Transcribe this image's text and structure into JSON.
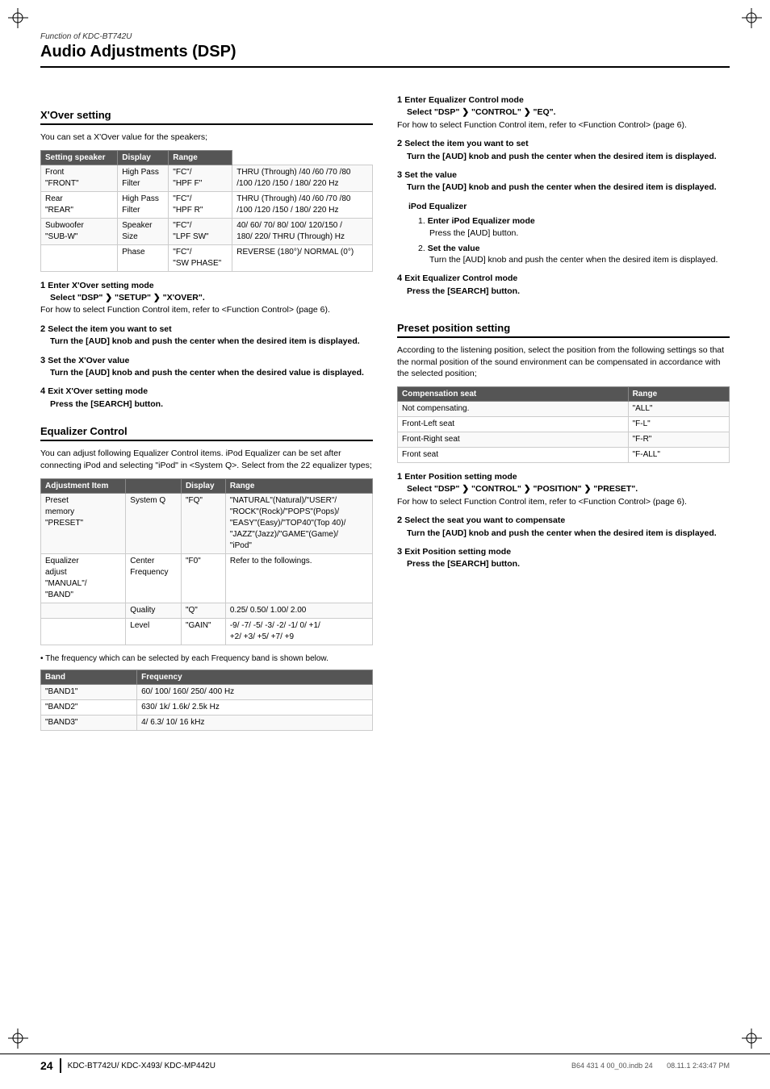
{
  "page": {
    "subtitle": "Function of KDC-BT742U",
    "title": "Audio Adjustments (DSP)"
  },
  "xover": {
    "heading": "X'Over setting",
    "intro": "You can set a X'Over value for the speakers;",
    "table": {
      "headers": [
        "Setting speaker",
        "Display",
        "Range"
      ],
      "rows": [
        [
          "Front\n\"FRONT\"",
          "High Pass Filter",
          "\"FC\"/\n\"HPF F\"",
          "THRU (Through) /40 /60 /70 /80\n/100 /120 /150 / 180/ 220 Hz"
        ],
        [
          "Rear\n\"REAR\"",
          "High Pass Filter",
          "\"FC\"/\n\"HPF R\"",
          "THRU (Through) /40 /60 /70 /80\n/100 /120 /150 / 180/ 220 Hz"
        ],
        [
          "Subwoofer\n\"SUB-W\"",
          "Speaker Size",
          "\"FC\"/\n\"LPF SW\"",
          "40/ 60/ 70/ 80/ 100/ 120/150 /\n180/ 220/ THRU (Through) Hz"
        ],
        [
          "",
          "Phase",
          "\"FC\"/\n\"SW PHASE\"",
          "REVERSE (180°)/ NORMAL (0°)"
        ]
      ]
    },
    "steps": [
      {
        "num": "1",
        "title": "Enter X'Over setting mode",
        "bold": "Select \"DSP\" ❯ \"SETUP\" ❯ \"X'OVER\".",
        "detail": "For how to select Function Control item, refer to <Function Control> (page 6)."
      },
      {
        "num": "2",
        "title": "Select the item you want to set",
        "bold": "Turn the [AUD] knob and push the center when the desired item is displayed."
      },
      {
        "num": "3",
        "title": "Set the X'Over value",
        "bold": "Turn the [AUD] knob and push the center when the desired value is displayed."
      },
      {
        "num": "4",
        "title": "Exit X'Over setting mode",
        "bold": "Press the [SEARCH] button."
      }
    ]
  },
  "equalizer": {
    "heading": "Equalizer Control",
    "intro": "You can adjust following Equalizer Control items. iPod Equalizer can be set after connecting iPod and selecting \"iPod\" in <System Q>. Select from the 22 equalizer types;",
    "table": {
      "headers": [
        "Adjustment Item",
        "",
        "Display",
        "Range"
      ],
      "rows": [
        [
          "Preset memory\n\"PRESET\"",
          "System Q",
          "\"FQ\"",
          "\"NATURAL\"(Natural)/\"USER\"/\n\"ROCK\"(Rock)/\"POPS\"(Pops)/\n\"EASY\"(Easy)/\"TOP40\"(Top 40)/\n\"JAZZ\"(Jazz)/\"GAME\"(Game)/\n\"iPod\""
        ],
        [
          "Equalizer adjust\n\"MANUAL\"/\n\"BAND\"",
          "Center Frequency",
          "\"F0\"",
          "Refer to the followings."
        ],
        [
          "",
          "Quality",
          "\"Q\"",
          "0.25/ 0.50/ 1.00/ 2.00"
        ],
        [
          "",
          "Level",
          "\"GAIN\"",
          "-9/ -7/ -5/ -3/ -2/ -1/ 0/ +1/\n+2/ +3/ +5/ +7/ +9"
        ]
      ]
    },
    "bullet_note": "The frequency which can be selected by each Frequency band is shown below.",
    "band_table": {
      "headers": [
        "Band",
        "Frequency"
      ],
      "rows": [
        [
          "\"BAND1\"",
          "60/ 100/ 160/ 250/ 400 Hz"
        ],
        [
          "\"BAND2\"",
          "630/ 1k/ 1.6k/ 2.5k Hz"
        ],
        [
          "\"BAND3\"",
          "4/ 6.3/ 10/ 16 kHz"
        ]
      ]
    },
    "steps": [
      {
        "num": "1",
        "title": "Enter Equalizer Control mode",
        "bold": "Select \"DSP\" ❯ \"CONTROL\" ❯ \"EQ\".",
        "detail": "For how to select Function Control item, refer to <Function Control> (page 6)."
      },
      {
        "num": "2",
        "title": "Select the item you want to set",
        "bold": "Turn the [AUD] knob and push the center when the desired item is displayed."
      },
      {
        "num": "3",
        "title": "Set the value",
        "bold": "Turn the [AUD] knob and push the center when the desired item is displayed."
      },
      {
        "num": "ipod",
        "title": "iPod Equalizer",
        "substeps": [
          {
            "num": "1",
            "title": "Enter iPod Equalizer mode",
            "detail": "Press the [AUD] button."
          },
          {
            "num": "2",
            "title": "Set the value",
            "detail": "Turn the [AUD] knob and push the center when the desired item is displayed."
          }
        ]
      },
      {
        "num": "4",
        "title": "Exit Equalizer Control mode",
        "bold": "Press the [SEARCH] button."
      }
    ]
  },
  "preset": {
    "heading": "Preset position setting",
    "intro": "According to the listening position, select the position from the following settings so that the normal position of the sound environment can be compensated in accordance with the selected position;",
    "table": {
      "headers": [
        "Compensation seat",
        "Range"
      ],
      "rows": [
        [
          "Not compensating.",
          "\"ALL\""
        ],
        [
          "Front-Left seat",
          "\"F-L\""
        ],
        [
          "Front-Right seat",
          "\"F-R\""
        ],
        [
          "Front seat",
          "\"F-ALL\""
        ]
      ]
    },
    "steps": [
      {
        "num": "1",
        "title": "Enter Position setting mode",
        "bold": "Select \"DSP\" ❯ \"CONTROL\" ❯ \"POSITION\" ❯ \"PRESET\".",
        "detail": "For how to select Function Control item, refer to <Function Control> (page 6)."
      },
      {
        "num": "2",
        "title": "Select the seat you want to compensate",
        "bold": "Turn the [AUD] knob and push the center when the desired item is displayed."
      },
      {
        "num": "3",
        "title": "Exit Position setting mode",
        "bold": "Press the [SEARCH] button."
      }
    ]
  },
  "footer": {
    "page_num": "24",
    "models": "KDC-BT742U/ KDC-X493/ KDC-MP442U",
    "file_info": "B64 431 4 00_00.indb   24",
    "timestamp": "08.11.1   2:43:47 PM"
  }
}
